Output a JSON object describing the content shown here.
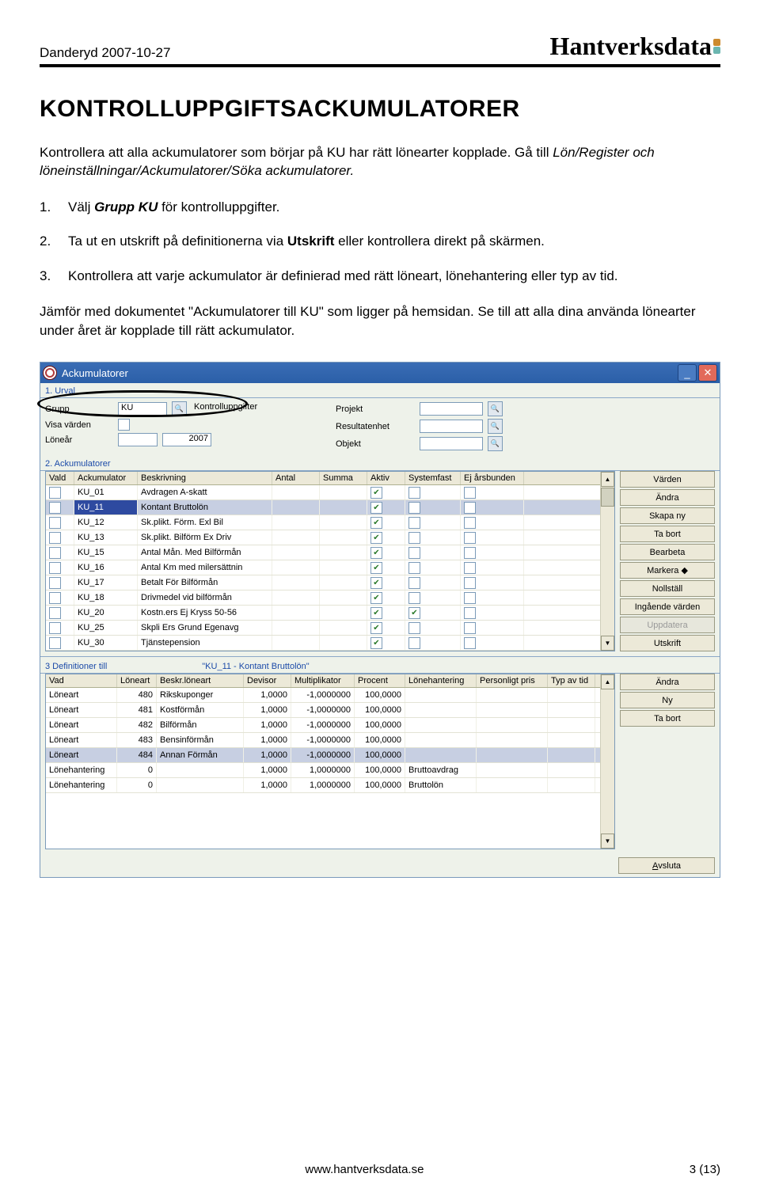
{
  "header": {
    "left": "Danderyd 2007-10-27",
    "brand": "Hantverksdata"
  },
  "title": "KONTROLLUPPGIFTSACKUMULATORER",
  "intro1": "Kontrollera att alla ackumulatorer som börjar på KU har rätt lönearter kopplade. Gå till ",
  "intro1_em": "Lön/Register och löneinställningar/Ackumulatorer/Söka ackumulatorer.",
  "steps": [
    {
      "n": "1.",
      "t_pre": "Välj ",
      "t_b": "Grupp KU",
      "t_post": " för kontrolluppgifter."
    },
    {
      "n": "2.",
      "t_pre": "Ta ut en utskrift på definitionerna via ",
      "t_b": "Utskrift",
      "t_post": " eller kontrollera direkt på skärmen."
    },
    {
      "n": "3.",
      "t_pre": "Kontrollera att varje ackumulator är definierad med rätt löneart, lönehantering eller typ av tid.",
      "t_b": "",
      "t_post": ""
    }
  ],
  "para2": "Jämför med dokumentet \"Ackumulatorer till KU\" som ligger på hemsidan. Se till att alla dina använda lönearter under året är kopplade till rätt ackumulator.",
  "win": {
    "title": "Ackumulatorer"
  },
  "sec": {
    "urval": "1. Urval",
    "ack": "2. Ackumulatorer",
    "def": "3 Definitioner till",
    "def_sub": "\"KU_11 - Kontant Bruttolön\""
  },
  "urval": {
    "grupp_lbl": "Grupp",
    "grupp": "KU",
    "grupp_txt": "Kontrolluppgifter",
    "visa_lbl": "Visa värden",
    "lonear_lbl": "Löneår",
    "lonear": "2007",
    "projekt_lbl": "Projekt",
    "resultat_lbl": "Resultatenhet",
    "objekt_lbl": "Objekt"
  },
  "g2": {
    "cols": [
      "Vald",
      "Ackumulator",
      "Beskrivning",
      "Antal",
      "Summa",
      "Aktiv",
      "Systemfast",
      "Ej årsbunden"
    ],
    "rows": [
      {
        "a": "KU_01",
        "b": "Avdragen A-skatt",
        "akt": true,
        "sys": false,
        "ej": false
      },
      {
        "a": "KU_11",
        "b": "Kontant Bruttolön",
        "akt": true,
        "sys": false,
        "ej": false,
        "sel": true
      },
      {
        "a": "KU_12",
        "b": "Sk.plikt. Förm. Exl Bil",
        "akt": true,
        "sys": false,
        "ej": false
      },
      {
        "a": "KU_13",
        "b": "Sk.plikt. Bilförm Ex Driv",
        "akt": true,
        "sys": false,
        "ej": false
      },
      {
        "a": "KU_15",
        "b": "Antal Mån. Med Bilförmån",
        "akt": true,
        "sys": false,
        "ej": false
      },
      {
        "a": "KU_16",
        "b": "Antal Km med milersättnin",
        "akt": true,
        "sys": false,
        "ej": false
      },
      {
        "a": "KU_17",
        "b": "Betalt För Bilförmån",
        "akt": true,
        "sys": false,
        "ej": false
      },
      {
        "a": "KU_18",
        "b": "Drivmedel vid bilförmån",
        "akt": true,
        "sys": false,
        "ej": false
      },
      {
        "a": "KU_20",
        "b": "Kostn.ers Ej Kryss 50-56",
        "akt": true,
        "sys": true,
        "ej": false
      },
      {
        "a": "KU_25",
        "b": "Skpli Ers Grund Egenavg",
        "akt": true,
        "sys": false,
        "ej": false
      },
      {
        "a": "KU_30",
        "b": "Tjänstepension",
        "akt": true,
        "sys": false,
        "ej": false
      }
    ],
    "btns": [
      "Värden",
      "Ändra",
      "Skapa ny",
      "Ta bort",
      "Bearbeta",
      "Markera    ◆",
      "Nollställ",
      "Ingående värden",
      "Uppdatera",
      "Utskrift"
    ]
  },
  "g3": {
    "cols": [
      "Vad",
      "Löneart",
      "Beskr.löneart",
      "Devisor",
      "Multiplikator",
      "Procent",
      "Lönehantering",
      "Personligt pris",
      "Typ av tid"
    ],
    "rows": [
      {
        "v": "Löneart",
        "l": "480",
        "b": "Rikskuponger",
        "d": "1,0000",
        "m": "-1,0000000",
        "p": "100,0000",
        "lh": "",
        "tt": ""
      },
      {
        "v": "Löneart",
        "l": "481",
        "b": "Kostförmån",
        "d": "1,0000",
        "m": "-1,0000000",
        "p": "100,0000",
        "lh": "",
        "tt": ""
      },
      {
        "v": "Löneart",
        "l": "482",
        "b": "Bilförmån",
        "d": "1,0000",
        "m": "-1,0000000",
        "p": "100,0000",
        "lh": "",
        "tt": ""
      },
      {
        "v": "Löneart",
        "l": "483",
        "b": "Bensinförmån",
        "d": "1,0000",
        "m": "-1,0000000",
        "p": "100,0000",
        "lh": "",
        "tt": ""
      },
      {
        "v": "Löneart",
        "l": "484",
        "b": "Annan Förmån",
        "d": "1,0000",
        "m": "-1,0000000",
        "p": "100,0000",
        "lh": "",
        "tt": "",
        "sel": true
      },
      {
        "v": "Lönehantering",
        "l": "0",
        "b": "",
        "d": "1,0000",
        "m": "1,0000000",
        "p": "100,0000",
        "lh": "Bruttoavdrag",
        "tt": ""
      },
      {
        "v": "Lönehantering",
        "l": "0",
        "b": "",
        "d": "1,0000",
        "m": "1,0000000",
        "p": "100,0000",
        "lh": "Bruttolön",
        "tt": ""
      }
    ],
    "btns": [
      "Ändra",
      "Ny",
      "Ta bort"
    ],
    "close": "Avsluta"
  },
  "footer": {
    "url": "www.hantverksdata.se",
    "page": "3 (13)"
  }
}
